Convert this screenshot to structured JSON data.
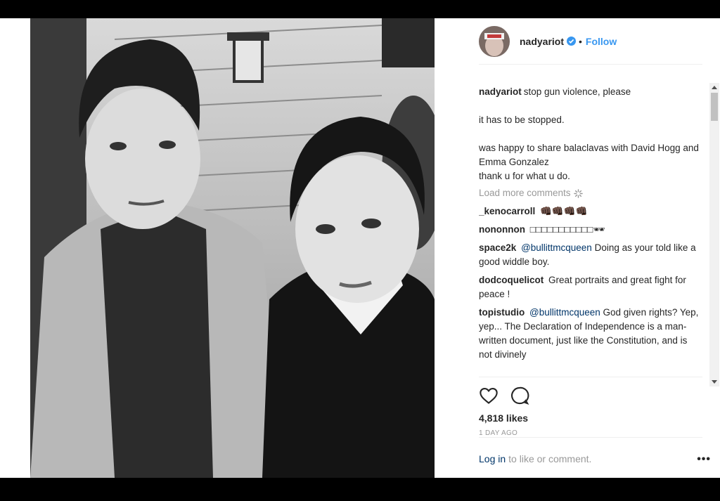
{
  "post": {
    "username": "nadyariot",
    "follow_label": "Follow",
    "dot": "•"
  },
  "caption": {
    "username": "nadyariot",
    "line1": "stop gun violence, please",
    "line2": "it has to be stopped.",
    "line3": "was happy to share balaclavas with David Hogg and Emma Gonzalez",
    "line4": "thank u for what u do."
  },
  "load_more_label": "Load more comments",
  "comments": [
    {
      "username": "_kenocarroll",
      "text": "👊🏿👊🏿👊🏿👊🏿"
    },
    {
      "username": "nononnon",
      "text": "□□□□□□□□□□□🕶"
    },
    {
      "username": "space2k",
      "mention": "@bullittmcqueen",
      "text": "Doing as your told like a good widdle boy."
    },
    {
      "username": "dodcoquelicot",
      "text": "Great portraits and great fight for peace !"
    },
    {
      "username": "topistudio",
      "mention": "@bullittmcqueen",
      "text": "God given rights? Yep, yep... The Declaration of Independence is a man-written document, just like the Constitution, and is not divinely"
    }
  ],
  "likes": "4,818 likes",
  "time_ago": "1 DAY AGO",
  "login": {
    "link": "Log in",
    "text": "to like or comment.",
    "more": "•••"
  },
  "colors": {
    "accent": "#3897f0",
    "link": "#003569",
    "muted": "#999999",
    "text": "#262626"
  },
  "icons": [
    "verified-badge-icon",
    "heart-icon",
    "comment-icon",
    "spinner-icon",
    "more-options-icon"
  ]
}
